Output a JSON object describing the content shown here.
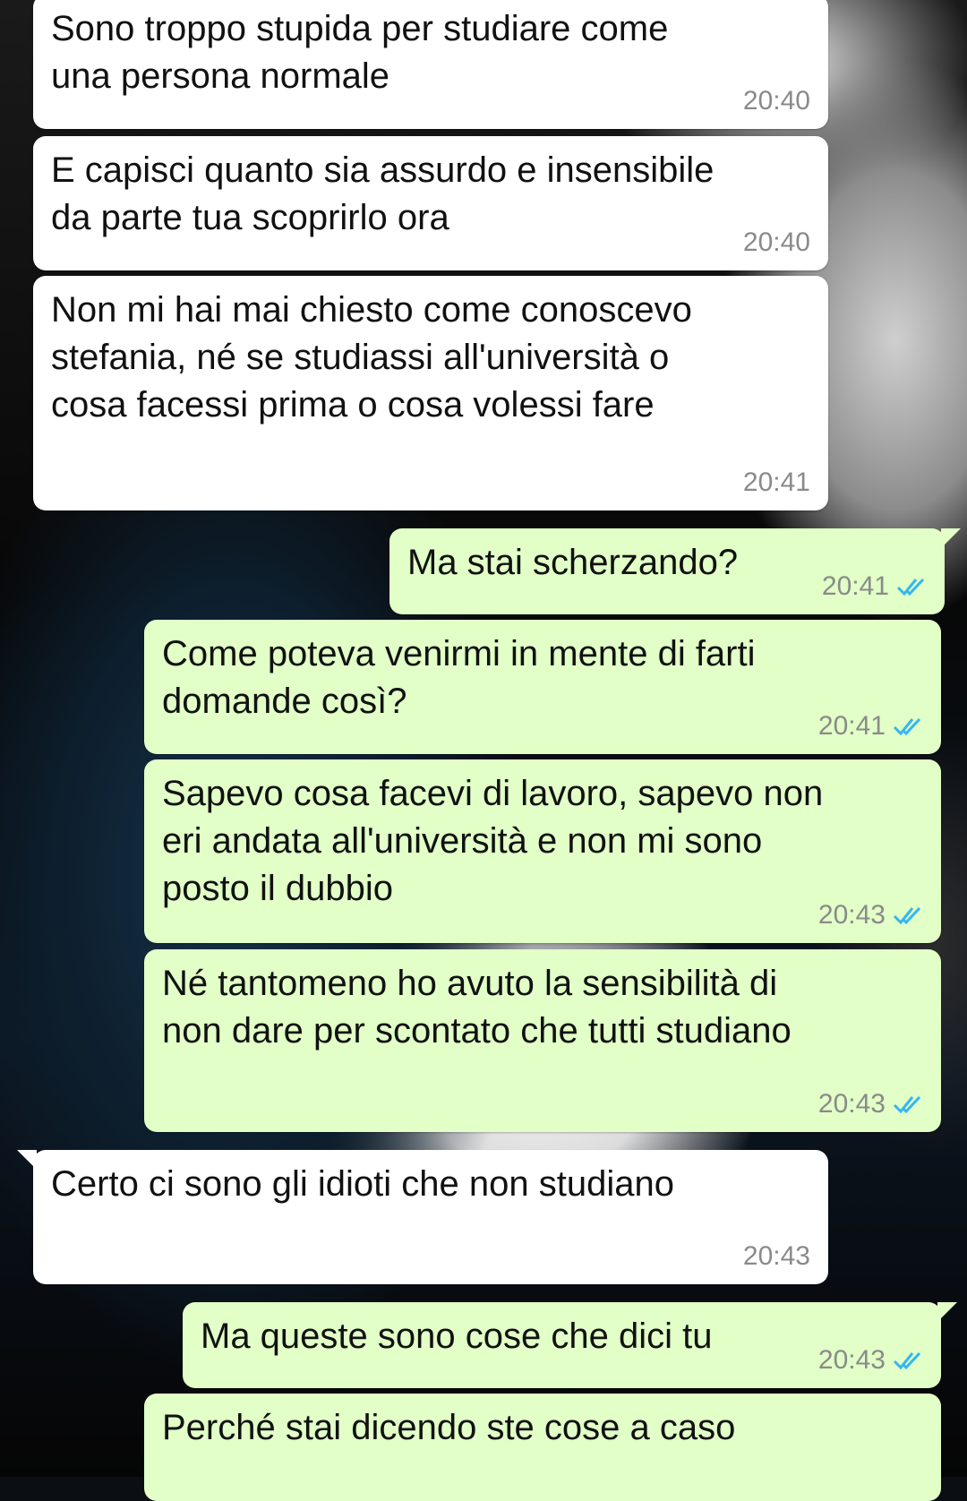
{
  "chat": {
    "incoming_bubble_color": "#ffffff",
    "outgoing_bubble_color": "#e1ffc7",
    "read_ticks_color": "#34b7f1",
    "messages": [
      {
        "text": "Sono troppo stupida per studiare come\nuna persona normale",
        "time": "20:40"
      },
      {
        "text": "E capisci quanto sia assurdo e insensibile\nda parte tua scoprirlo ora",
        "time": "20:40"
      },
      {
        "text": "Non mi hai mai chiesto come conoscevo\nstefania, né se studiassi all'università o\ncosa facessi prima o cosa volessi fare",
        "time": "20:41"
      },
      {
        "text": "Ma stai scherzando?",
        "time": "20:41",
        "status_icon": "double-check-read-icon"
      },
      {
        "text": "Come poteva venirmi in mente di farti\ndomande così?",
        "time": "20:41",
        "status_icon": "double-check-read-icon"
      },
      {
        "text": "Sapevo cosa facevi di lavoro, sapevo non\neri andata all'università e non mi sono\nposto il dubbio",
        "time": "20:43",
        "status_icon": "double-check-read-icon"
      },
      {
        "text": "Né tantomeno ho avuto la sensibilità di\nnon dare per scontato che tutti studiano",
        "time": "20:43",
        "status_icon": "double-check-read-icon"
      },
      {
        "text": "Certo ci sono gli idioti che non studiano",
        "time": "20:43"
      },
      {
        "text": "Ma queste sono cose che dici tu",
        "time": "20:43",
        "status_icon": "double-check-read-icon"
      },
      {
        "text": "Perché stai dicendo ste cose a caso",
        "time": ""
      }
    ]
  }
}
